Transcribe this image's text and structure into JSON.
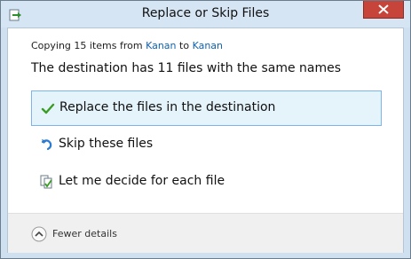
{
  "window": {
    "title": "Replace or Skip Files"
  },
  "info": {
    "copying_prefix": "Copying 15 items from ",
    "source": "Kanan",
    "to_text": " to ",
    "destination": "Kanan",
    "headline": "The destination has 11 files with the same names"
  },
  "options": [
    {
      "label": "Replace the files in the destination",
      "icon": "checkmark-icon",
      "selected": true
    },
    {
      "label": "Skip these files",
      "icon": "skip-arrow-icon",
      "selected": false
    },
    {
      "label": "Let me decide for each file",
      "icon": "compare-files-icon",
      "selected": false
    }
  ],
  "footer": {
    "details_label": "Fewer details",
    "details_icon": "chevron-up-icon"
  },
  "colors": {
    "titlebar": "#d6e5f3",
    "close": "#c7443a",
    "link": "#0d63b3",
    "selection_bg": "#e5f3fb",
    "selection_border": "#7eb4ea",
    "check_green": "#3a9d23"
  }
}
